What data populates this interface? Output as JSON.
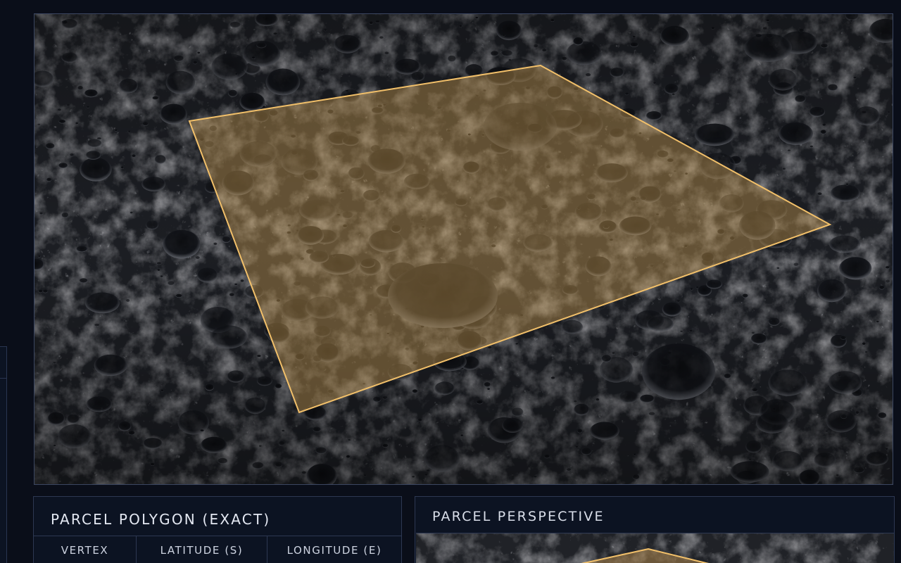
{
  "polygon_panel": {
    "title": "PARCEL POLYGON (EXACT)",
    "columns": [
      "VERTEX",
      "LATITUDE (S)",
      "LONGITUDE (E)"
    ]
  },
  "perspective_panel": {
    "title": "PARCEL PERSPECTIVE"
  },
  "parcel": {
    "outline_color": "#f2c06a",
    "fill_color": "#c99a52"
  }
}
